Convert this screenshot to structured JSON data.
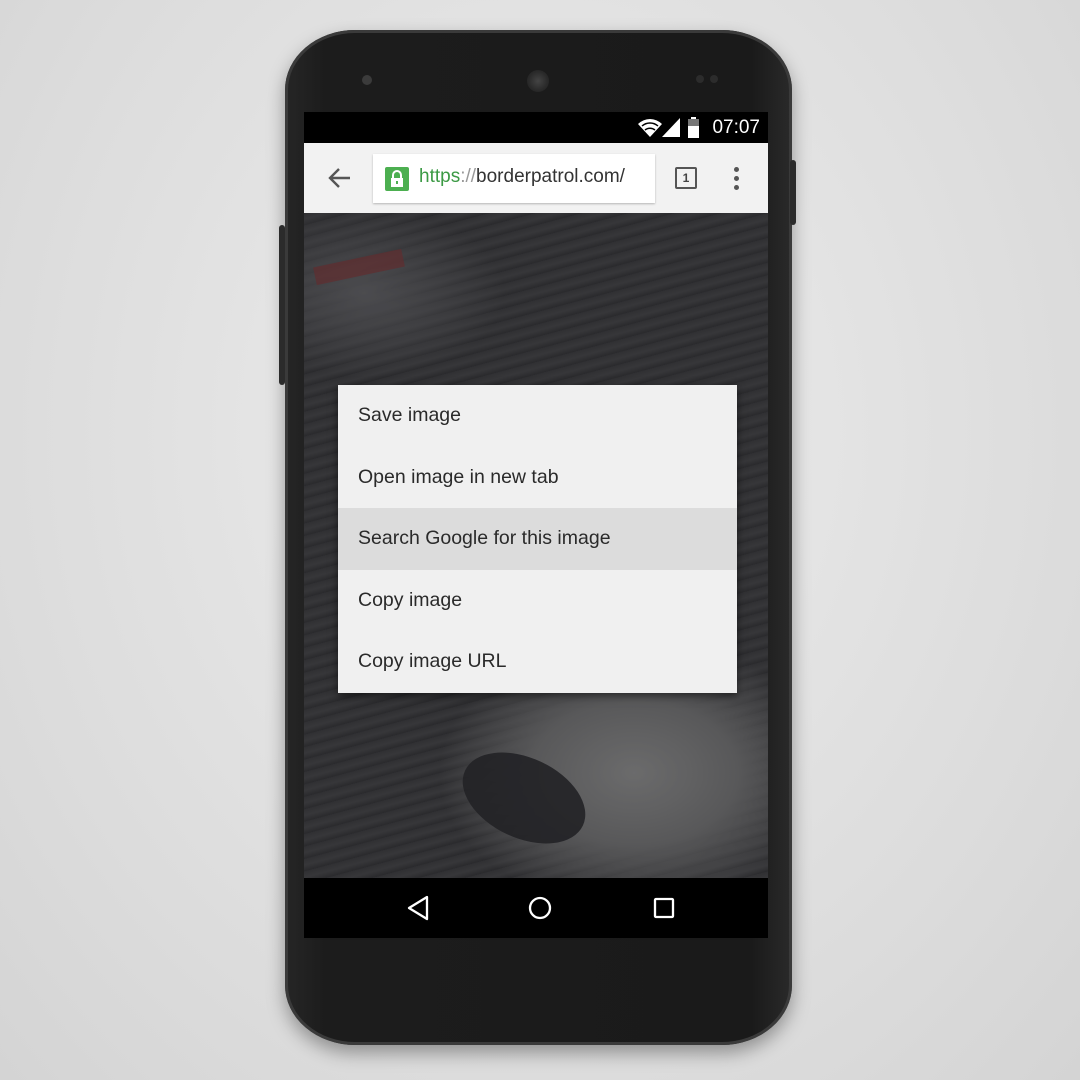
{
  "status_bar": {
    "time": "07:07",
    "icons": [
      "wifi-icon",
      "signal-icon",
      "battery-icon"
    ]
  },
  "toolbar": {
    "url_scheme": "https",
    "url_separator": "://",
    "url_host": "borderpatrol.com/",
    "tab_count": "1",
    "lock_color": "#4caf50"
  },
  "context_menu": {
    "items": [
      {
        "label": "Save image"
      },
      {
        "label": "Open image in new tab"
      },
      {
        "label": "Search Google for this image",
        "highlighted": true
      },
      {
        "label": "Copy image"
      },
      {
        "label": "Copy image URL"
      }
    ]
  },
  "nav_bar": {
    "icons": [
      "back-triangle-icon",
      "home-circle-icon",
      "recents-square-icon"
    ]
  }
}
